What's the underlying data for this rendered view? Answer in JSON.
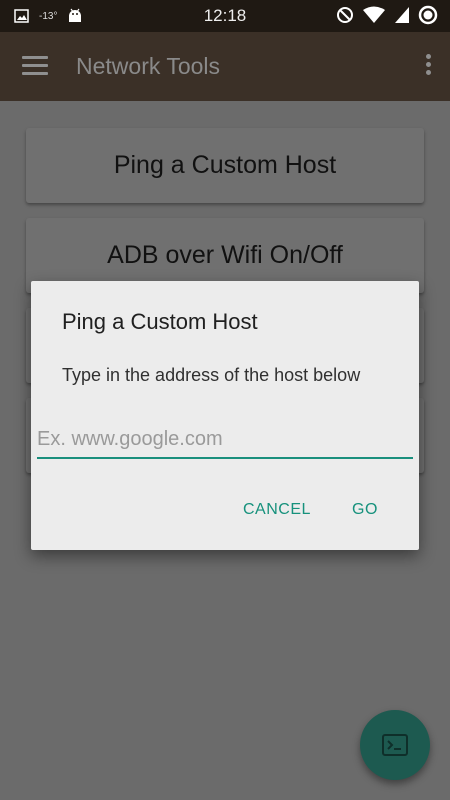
{
  "status_bar": {
    "time": "12:18",
    "temperature": "-13°",
    "left_icons": [
      "image-icon",
      "android-icon"
    ],
    "right_icons": [
      "do-not-disturb-icon",
      "wifi-icon",
      "signal-icon",
      "battery-icon"
    ]
  },
  "app_bar": {
    "title": "Network Tools",
    "menu_icon": "hamburger-menu-icon",
    "overflow_icon": "more-vert-icon"
  },
  "main": {
    "buttons": [
      {
        "label": "Ping a Custom Host"
      },
      {
        "label": "ADB over Wifi On/Off"
      }
    ]
  },
  "dialog": {
    "title": "Ping a Custom Host",
    "message": "Type in the address of the host below",
    "input_value": "",
    "input_placeholder": "Ex. www.google.com",
    "cancel_label": "CANCEL",
    "go_label": "GO"
  },
  "fab": {
    "icon": "terminal-icon"
  },
  "colors": {
    "accent": "#16917c",
    "app_bar": "#3b3027",
    "status_bar": "#1f1913",
    "fab": "#1d5a50"
  }
}
